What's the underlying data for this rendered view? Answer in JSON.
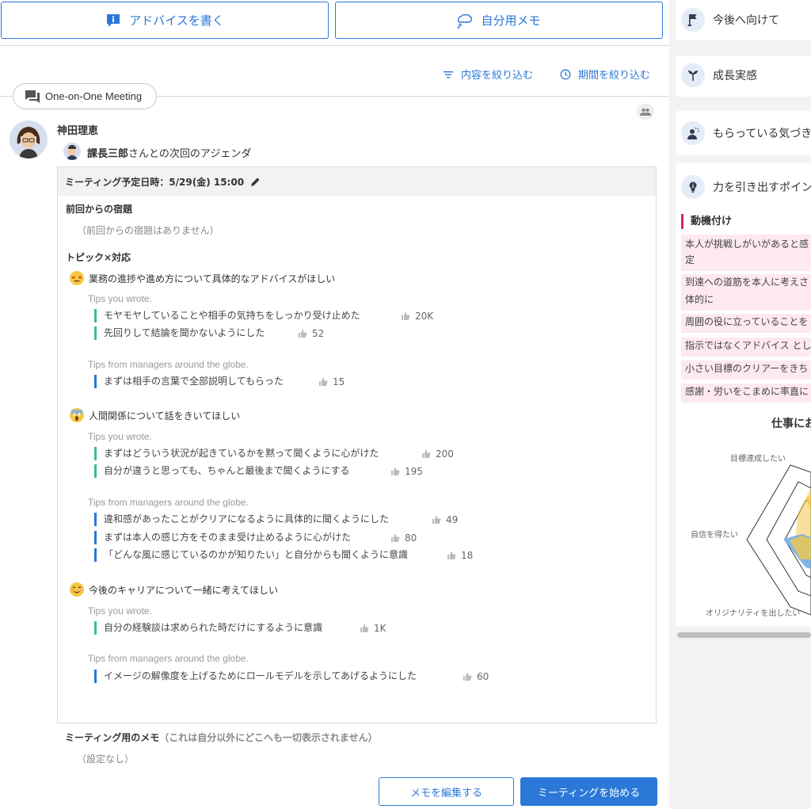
{
  "top_buttons": {
    "advice": "アドバイスを書く",
    "memo": "自分用メモ"
  },
  "filters": {
    "content": "内容を絞り込む",
    "period": "期間を絞り込む"
  },
  "meeting_pill": "One-on-One Meeting",
  "user": {
    "name": "神田理恵"
  },
  "agenda": {
    "partner": "課長三郎",
    "title_suffix": "さんとの次回のアジェンダ",
    "datetime": "ミーティング予定日時：5/29(金) 15:00",
    "homework_title": "前回からの宿題",
    "homework_empty": "（前回からの宿題はありません）",
    "topics_title": "トピック×対応",
    "topics": [
      {
        "title": "業務の進捗や進め方について具体的なアドバイスがほしい",
        "wrote_label": "Tips you wrote.",
        "wrote": [
          {
            "text": "モヤモヤしていることや相手の気持ちをしっかり受け止めた",
            "likes": "20K"
          },
          {
            "text": "先回りして結論を聞かないようにした",
            "likes": "52"
          }
        ],
        "global_label": "Tips from managers around the globe.",
        "global": [
          {
            "text": "まずは相手の言葉で全部説明してもらった",
            "likes": "15"
          }
        ]
      },
      {
        "title": "人間関係について話をきいてほしい",
        "wrote_label": "Tips you wrote.",
        "wrote": [
          {
            "text": "まずはどういう状況が起きているかを黙って聞くように心がけた",
            "likes": "200"
          },
          {
            "text": "自分が違うと思っても、ちゃんと最後まで聞くようにする",
            "likes": "195"
          }
        ],
        "global_label": "Tips from managers around the globe.",
        "global": [
          {
            "text": "違和感があったことがクリアになるように具体的に聞くようにした",
            "likes": "49"
          },
          {
            "text": "まずは本人の感じ方をそのまま受け止めるように心がけた",
            "likes": "80"
          },
          {
            "text": "「どんな風に感じているのかが知りたい」と自分からも聞くように意識",
            "likes": "18"
          }
        ]
      },
      {
        "title": "今後のキャリアについて一緒に考えてほしい",
        "wrote_label": "Tips you wrote.",
        "wrote": [
          {
            "text": "自分の経験談は求められた時だけにするように意識",
            "likes": "1K"
          }
        ],
        "global_label": "Tips from managers around the globe.",
        "global": [
          {
            "text": "イメージの解像度を上げるためにロールモデルを示してあげるようにした",
            "likes": "60"
          }
        ]
      }
    ]
  },
  "memo": {
    "title": "ミーティング用のメモ",
    "note": "（これは自分以外にどこへも一切表示されません）",
    "value": "（設定なし）"
  },
  "actions": {
    "edit_memo": "メモを編集する",
    "start_meeting": "ミーティングを始める"
  },
  "sidebar": {
    "cards": [
      "今後へ向けて",
      "成長実感",
      "もらっている気づき",
      "力を引き出すポイン"
    ],
    "motivation_title": "動機付け",
    "motivation_items": [
      "本人が挑戦しがいがあると感",
      "定",
      "到達への道筋を本人に考えさ",
      "体的に",
      "周囲の役に立っていることを",
      "指示ではなくアドバイス とし",
      "小さい目標のクリアーをきち",
      "感謝・労いをこまめに率直に"
    ],
    "chart_title": "仕事にお",
    "radar_labels": [
      "目標達成したい",
      "自信を得たい",
      "オリジナリティを出したい"
    ]
  },
  "colors": {
    "accent": "#2b78d8",
    "green_tip": "#3fbf7f",
    "motivation_bar": "#d92858",
    "motivation_bg": "#fde9ef"
  }
}
